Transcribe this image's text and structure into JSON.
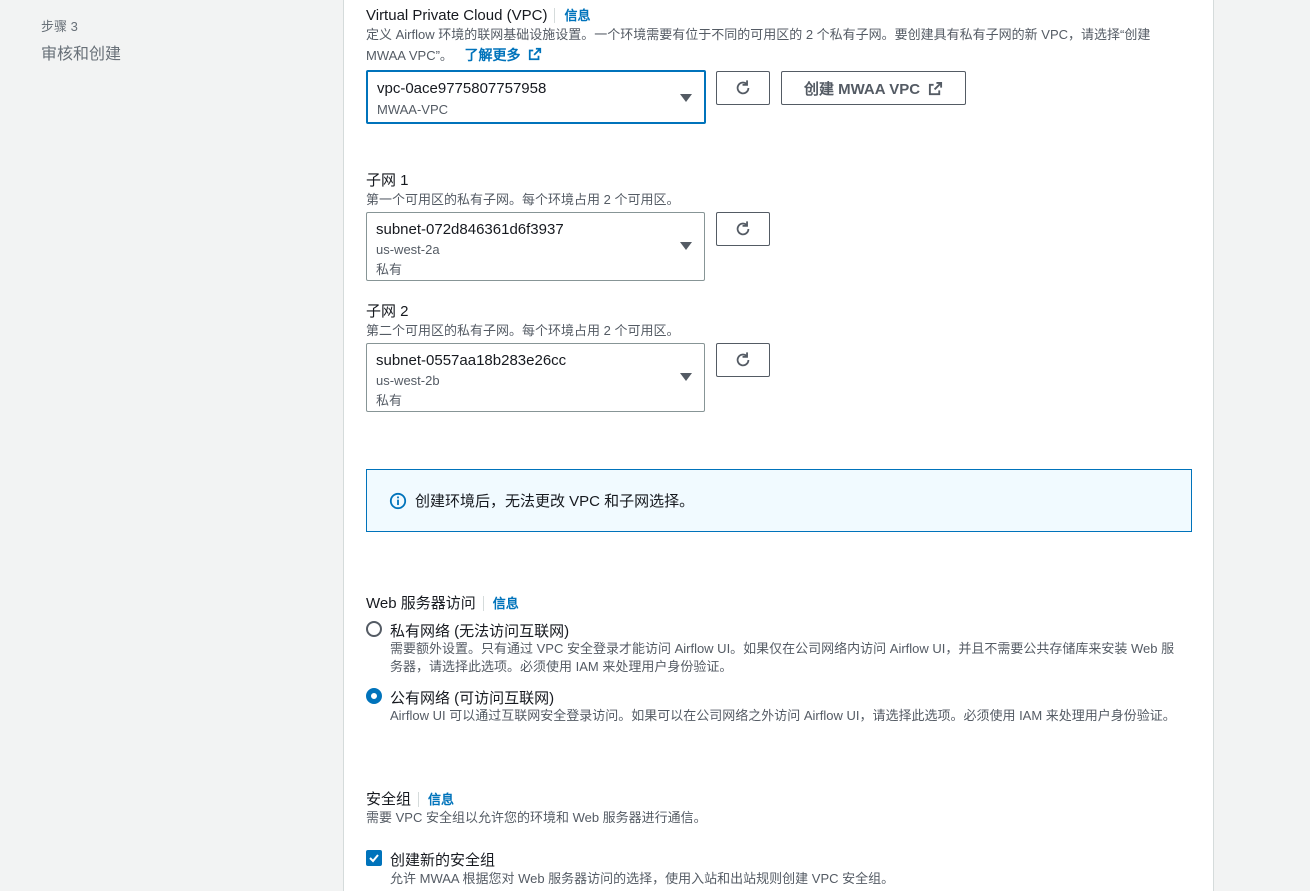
{
  "wizard": {
    "step_label": "步骤 3",
    "step_title": "审核和创建"
  },
  "vpc": {
    "label": "Virtual Private Cloud (VPC)",
    "info": "信息",
    "description": "定义 Airflow 环境的联网基础设施设置。一个环境需要有位于不同的可用区的 2 个私有子网。要创建具有私有子网的新 VPC，请选择“创建 MWAA VPC”。",
    "learn_more": "了解更多",
    "selected_value": "vpc-0ace9775807757958",
    "selected_sub": "MWAA-VPC",
    "create_button": "创建 MWAA VPC"
  },
  "subnet1": {
    "label": "子网 1",
    "description": "第一个可用区的私有子网。每个环境占用 2 个可用区。",
    "selected_value": "subnet-072d846361d6f3937",
    "zone": "us-west-2a",
    "type": "私有"
  },
  "subnet2": {
    "label": "子网 2",
    "description": "第二个可用区的私有子网。每个环境占用 2 个可用区。",
    "selected_value": "subnet-0557aa18b283e26cc",
    "zone": "us-west-2b",
    "type": "私有"
  },
  "alert": {
    "text": "创建环境后，无法更改 VPC 和子网选择。"
  },
  "web_access": {
    "label": "Web 服务器访问",
    "info": "信息",
    "options": [
      {
        "title": "私有网络 (无法访问互联网)",
        "description": "需要额外设置。只有通过 VPC 安全登录才能访问 Airflow UI。如果仅在公司网络内访问 Airflow UI，并且不需要公共存储库来安装 Web 服务器，请选择此选项。必须使用 IAM 来处理用户身份验证。",
        "checked": false
      },
      {
        "title": "公有网络 (可访问互联网)",
        "description": "Airflow UI 可以通过互联网安全登录访问。如果可以在公司网络之外访问 Airflow UI，请选择此选项。必须使用 IAM 来处理用户身份验证。",
        "checked": true
      }
    ]
  },
  "security_group": {
    "label": "安全组",
    "info": "信息",
    "description": "需要 VPC 安全组以允许您的环境和 Web 服务器进行通信。",
    "create_new_label": "创建新的安全组",
    "create_new_desc": "允许 MWAA 根据您对 Web 服务器访问的选择，使用入站和出站规则创建 VPC 安全组。",
    "checked": true
  },
  "colors": {
    "accent": "#0073bb",
    "text": "#16191f",
    "muted": "#545b64",
    "alert_bg": "#f1faff"
  }
}
